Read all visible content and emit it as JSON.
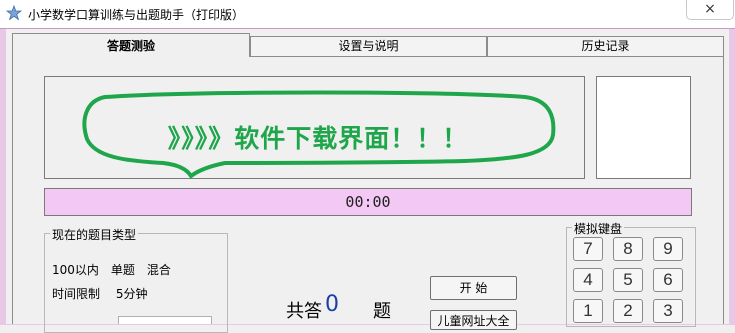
{
  "window": {
    "title": "小学数学口算训练与出题助手（打印版）",
    "close_icon": "×"
  },
  "colors": {
    "frame": "#e7c8e7",
    "timer_bg": "#f4c8f4",
    "banner_text": "#1fa64b",
    "count_value": "#1a3fa8"
  },
  "tabs": [
    {
      "label": "答题测验",
      "active": true
    },
    {
      "label": "设置与说明",
      "active": false
    },
    {
      "label": "历史记录",
      "active": false
    }
  ],
  "banner": {
    "text": "》》》》软件下载界面！！！"
  },
  "timer": {
    "value": "00:00"
  },
  "question_type": {
    "title": "现在的题目类型",
    "line1": "100以内　单题　混合",
    "line2": "时间限制　 5分钟"
  },
  "total": {
    "prefix": "共答",
    "value": "0",
    "suffix": "题"
  },
  "buttons": {
    "start": "开 始",
    "kids_sites": "儿童网址大全"
  },
  "keypad": {
    "title": "模拟键盘",
    "keys": [
      "7",
      "8",
      "9",
      "4",
      "5",
      "6",
      "1",
      "2",
      "3"
    ]
  }
}
